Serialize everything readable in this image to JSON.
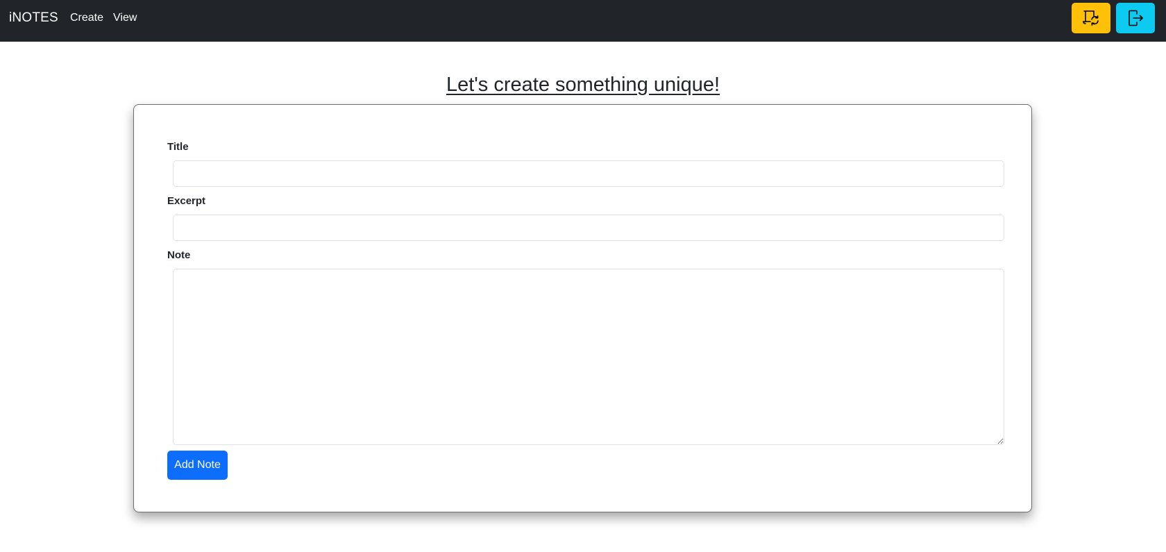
{
  "navbar": {
    "brand": "iNOTES",
    "links": [
      "Create",
      "View"
    ],
    "buttons": [
      {
        "icon": "calendar-refresh-icon",
        "color": "#ffc107"
      },
      {
        "icon": "logout-icon",
        "color": "#0dcaf0"
      }
    ],
    "background": "#212529"
  },
  "main": {
    "heading": "Let's create something unique!",
    "form": {
      "title_label": "Title",
      "title_value": "",
      "excerpt_label": "Excerpt",
      "excerpt_value": "",
      "note_label": "Note",
      "note_value": "",
      "submit_label": "Add Note",
      "submit_color": "#0d6efd"
    }
  }
}
